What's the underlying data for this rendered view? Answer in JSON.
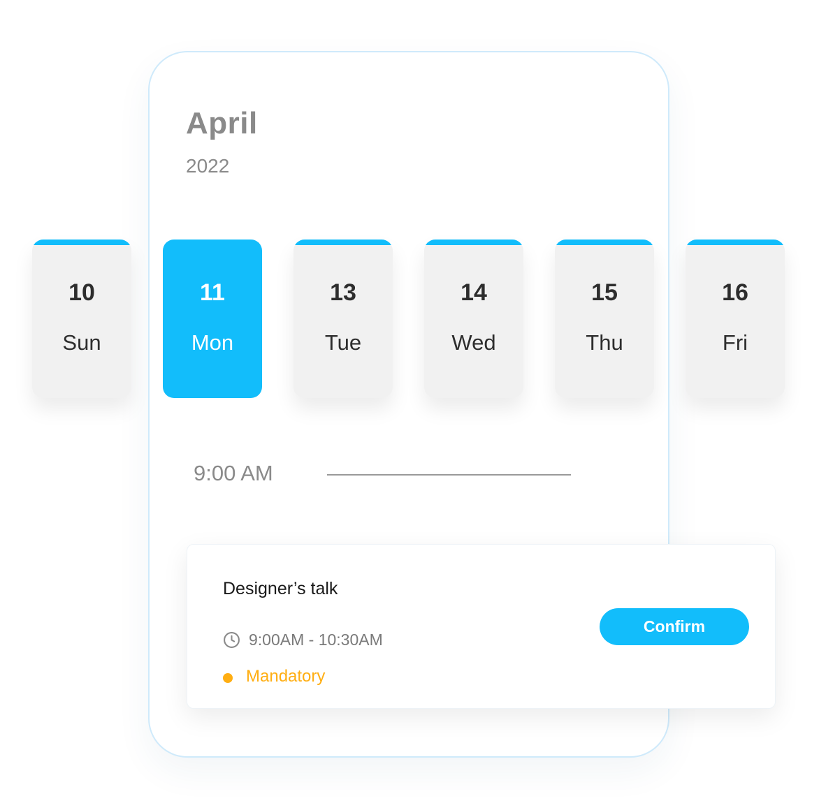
{
  "calendar": {
    "month": "April",
    "year": "2022"
  },
  "days": [
    {
      "num": "10",
      "name": "Sun",
      "selected": false
    },
    {
      "num": "11",
      "name": "Mon",
      "selected": true
    },
    {
      "num": "13",
      "name": "Tue",
      "selected": false
    },
    {
      "num": "14",
      "name": "Wed",
      "selected": false
    },
    {
      "num": "15",
      "name": "Thu",
      "selected": false
    },
    {
      "num": "16",
      "name": "Fri",
      "selected": false
    }
  ],
  "timeline": {
    "time_label": "9:00 AM"
  },
  "event": {
    "title": "Designer’s talk",
    "time_range": "9:00AM - 10:30AM",
    "tag": "Mandatory",
    "confirm_label": "Confirm",
    "time_icon": "clock-icon",
    "tag_icon": "dot-icon"
  },
  "colors": {
    "accent": "#12bdfb",
    "tag": "#ffae12",
    "card_bg": "#f1f1f1"
  }
}
